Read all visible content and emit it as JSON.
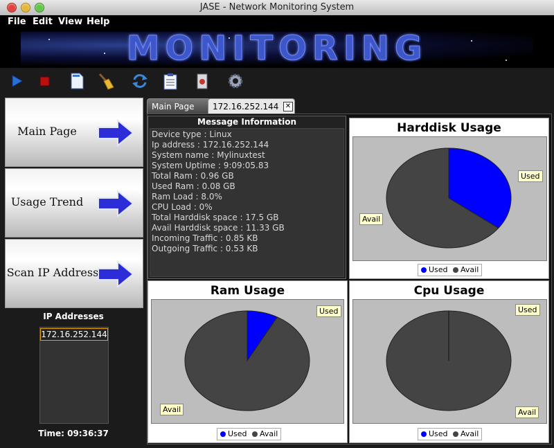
{
  "window": {
    "title": "JASE - Network Monitoring System"
  },
  "menu": [
    "File",
    "Edit",
    "View",
    "Help"
  ],
  "banner": {
    "text": "MONITORING"
  },
  "toolbar": {
    "icons": [
      "play-icon",
      "stop-icon",
      "document-icon",
      "broom-icon",
      "refresh-icon",
      "clipboard-icon",
      "settings-icon"
    ]
  },
  "sidebar": {
    "items": [
      {
        "label": "Main Page"
      },
      {
        "label": "Usage Trend"
      },
      {
        "label": "Scan IP Address"
      }
    ],
    "ip_title": "IP Addresses",
    "ip_list": [
      "172.16.252.144"
    ],
    "time": "Time: 09:36:37"
  },
  "tabs": [
    {
      "label": "Main Page"
    },
    {
      "label": "172.16.252.144"
    }
  ],
  "message": {
    "title": "Message Information",
    "lines": [
      "Device type : Linux",
      "Ip address : 172.16.252.144",
      "System name : Mylinuxtest",
      "System Uptime : 9:09:05.83",
      "Total Ram : 0.96 GB",
      "Used Ram : 0.08 GB",
      "Ram Load : 8.0%",
      "CPU Load : 0%",
      "Total Harddisk space : 17.5 GB",
      "Avail Harddisk space : 11.33 GB",
      "Incoming Traffic : 0.85 KB",
      "Outgoing Traffic : 0.53 KB"
    ]
  },
  "colors": {
    "used": "#0000ff",
    "avail": "#444444",
    "plot_bg": "#bdbdbd"
  },
  "chart_data": [
    {
      "type": "pie",
      "title": "Harddisk Usage",
      "categories": [
        "Used",
        "Avail"
      ],
      "values": [
        35.3,
        64.7
      ],
      "legend": "bottom"
    },
    {
      "type": "pie",
      "title": "Ram Usage",
      "categories": [
        "Used",
        "Avail"
      ],
      "values": [
        8.0,
        92.0
      ],
      "legend": "bottom"
    },
    {
      "type": "pie",
      "title": "Cpu Usage",
      "categories": [
        "Used",
        "Avail"
      ],
      "values": [
        0,
        100
      ],
      "legend": "bottom"
    }
  ]
}
